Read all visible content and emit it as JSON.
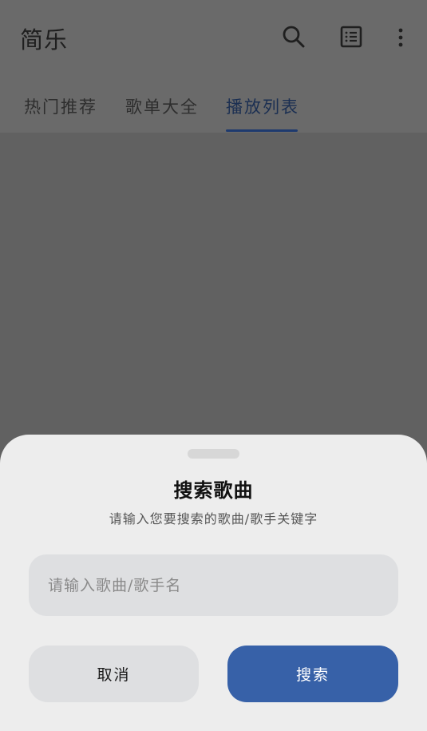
{
  "app": {
    "title": "简乐"
  },
  "tabs": [
    {
      "label": "热门推荐",
      "active": false
    },
    {
      "label": "歌单大全",
      "active": false
    },
    {
      "label": "播放列表",
      "active": true
    }
  ],
  "icons": {
    "search": "search-icon",
    "playlist": "list-icon",
    "more": "more-vert-icon"
  },
  "dialog": {
    "title": "搜索歌曲",
    "subtitle": "请输入您要搜索的歌曲/歌手关键字",
    "input": {
      "placeholder": "请输入歌曲/歌手名",
      "value": ""
    },
    "cancel_label": "取消",
    "search_label": "搜索"
  },
  "colors": {
    "accent": "#3761a8",
    "scrim": "#616161",
    "sheet": "#ededed"
  }
}
